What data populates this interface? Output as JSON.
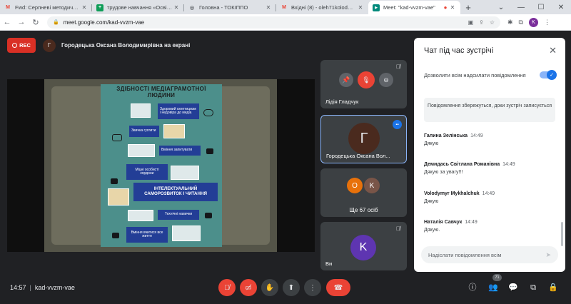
{
  "browser": {
    "tabs": [
      {
        "title": "Fwd: Серпневі методичні сту",
        "fav": "M",
        "fav_color": "#ea4335"
      },
      {
        "title": "трудове навчання «Освіта Т",
        "fav": "+",
        "fav_color": "#0f9d58"
      },
      {
        "title": "Головна - ТОКІППО",
        "fav": "◎",
        "fav_color": "#5f6368"
      },
      {
        "title": "Вхідні (8) - oleh71kolod@gm",
        "fav": "M",
        "fav_color": "#ea4335"
      },
      {
        "title": "Meet: \"kad-vvzm-vae\"",
        "fav": "▶",
        "fav_color": "#00897b"
      }
    ],
    "url": "meet.google.com/kad-vvzm-vae",
    "profile_initial": "K"
  },
  "meet": {
    "rec_label": "REC",
    "presenter_initial": "Г",
    "presenter_text": "Городецька Оксана Володимирівна на екрані",
    "slide": {
      "title": "ЗДІБНОСТІ МЕДІАГРАМОТНОЇ ЛЮДИНИ",
      "items": [
        "Здоровий скептицизм і недовіра до медіа",
        "Звичка гуглити",
        "Вміння запитувати",
        "Міцні особисті кордони",
        "ІНТЕЛЕКТУАЛЬНИЙ САМОРОЗВИТОК І ЧИТАННЯ",
        "Технічні навички",
        "Вміння вчитися все життя"
      ]
    },
    "tiles": [
      {
        "name": "Лідія Гладчук"
      },
      {
        "name": "Городецька Оксана Вол...",
        "initial": "Г"
      },
      {
        "name": "Ще 67 осіб",
        "initials": [
          "О",
          "K"
        ]
      },
      {
        "name": "Ви",
        "initial": "K"
      }
    ],
    "meeting_time": "14:57",
    "meeting_code": "kad-vvzm-vae",
    "people_count": "71"
  },
  "chat": {
    "title": "Чат під час зустрічі",
    "allow_label": "Дозволити всім надсилати повідомлення",
    "notice": "Повідомлення збережуться, доки зустріч записується",
    "messages": [
      {
        "author": "Галина Зелінська",
        "time": "14:49",
        "text": "Дякую"
      },
      {
        "author": "Демидась Світлана Романівна",
        "time": "14:49",
        "text": "Дякую за увагу!!!"
      },
      {
        "author": "Volodymyr Mykhalchuk",
        "time": "14:49",
        "text": "Дякую"
      },
      {
        "author": "Наталія Савчук",
        "time": "14:49",
        "text": "Дякую."
      }
    ],
    "input_placeholder": "Надіслати повідомлення всім"
  },
  "colors": {
    "accent": "#1a73e8",
    "danger": "#ea4335",
    "bg": "#202124"
  }
}
